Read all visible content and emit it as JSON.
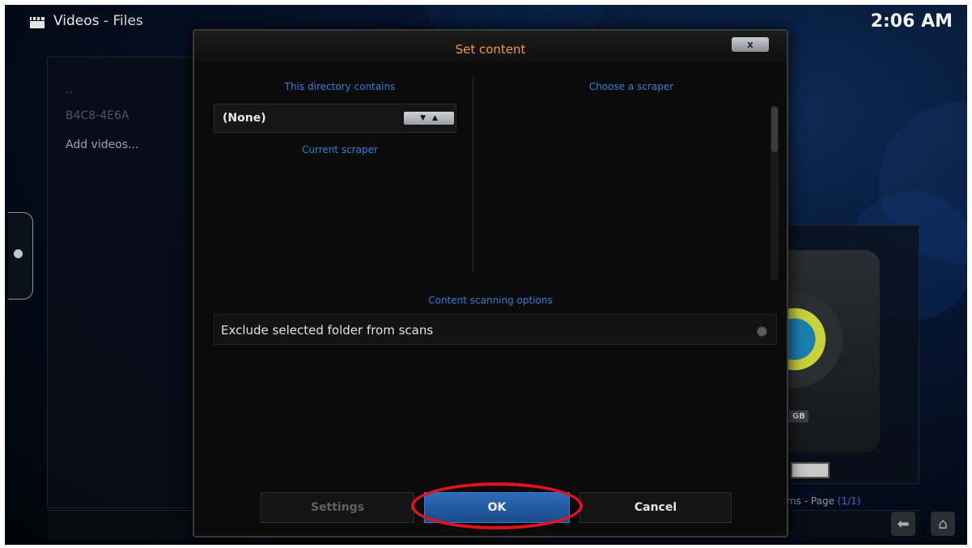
{
  "header": {
    "title": "Videos",
    "separator": "-",
    "subtitle": "Files",
    "clock": "2:06 AM"
  },
  "file_list": {
    "items": [
      {
        "label": ".."
      },
      {
        "label": "B4C8-4E6A"
      },
      {
        "label": "Add videos..."
      }
    ]
  },
  "preview": {
    "drive_label": "GB"
  },
  "footer": {
    "items_text": "ms - Page",
    "page": "(1/1)"
  },
  "dialog": {
    "title": "Set content",
    "close_label": "x",
    "directory_contains_label": "This directory contains",
    "content_type_value": "(None)",
    "current_scraper_label": "Current scraper",
    "choose_scraper_label": "Choose a scraper",
    "scanning_options_label": "Content scanning options",
    "exclude_option_label": "Exclude selected folder from scans",
    "exclude_option_checked": false,
    "buttons": {
      "settings": "Settings",
      "ok": "OK",
      "cancel": "Cancel"
    }
  },
  "colors": {
    "accent_title": "#e8a02a",
    "label_blue": "#2e7fd8",
    "ok_button": "#2c6cb8",
    "highlight_ring": "#e0121d"
  },
  "icons": {
    "header": "clapperboard-icon",
    "side_tab": "circle-dot-icon",
    "back": "back-arrow-icon",
    "home": "home-icon",
    "spin_down": "triangle-down-icon",
    "spin_up": "triangle-up-icon"
  }
}
